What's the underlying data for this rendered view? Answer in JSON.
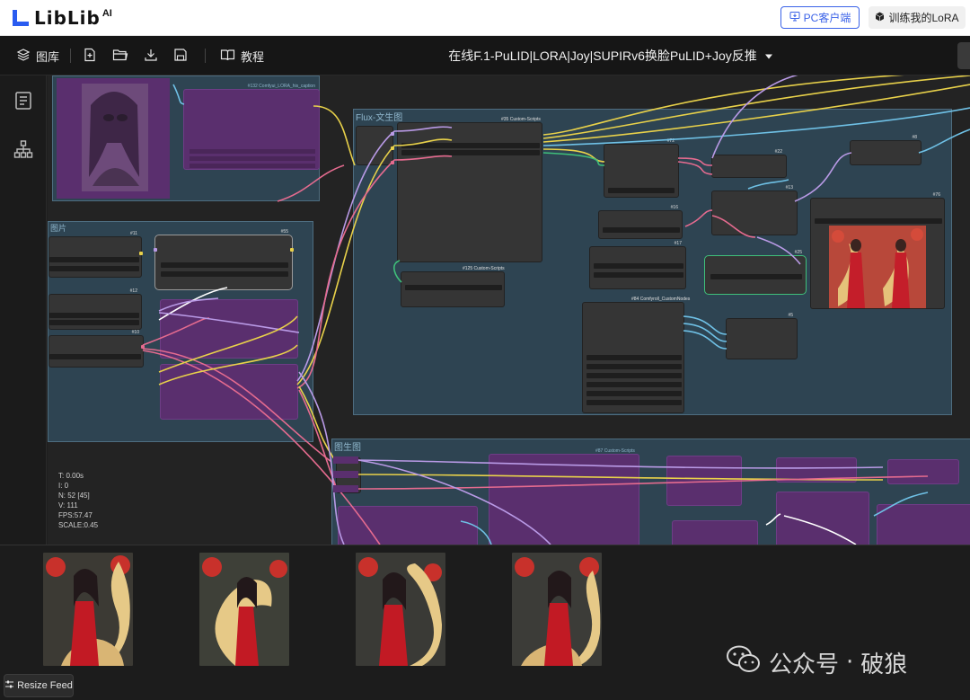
{
  "brand": {
    "logo_text": "LibLib",
    "logo_suffix": "AI"
  },
  "header": {
    "pc_client_label": "PC客户端",
    "train_lora_label": "训练我的LoRA"
  },
  "toolbar": {
    "gallery_label": "图库",
    "tutorial_label": "教程",
    "workflow_title": "在线F.1-PuLID|LORA|Joy|SUPIRv6换脸PuLID+Joy反推"
  },
  "canvas": {
    "groups": {
      "flux_txt2img": "Flux-文生图",
      "img2img": "图生图",
      "left_group": "图片"
    },
    "node_labels": {
      "custom_scripts_35": "#35 Custom-Scripts",
      "custom_scripts_125": "#125 Custom-Scripts",
      "custom_nodes_84": "#84 Comfyroll_CustomNodes",
      "custom_scripts_87": "#87 Custom-Scripts",
      "lora_caption": "#132 Comfyui_LORA_his_caption"
    },
    "node_ids": {
      "n11": "#11",
      "n55": "#55",
      "n12": "#12",
      "n10": "#10",
      "n72": "#72",
      "n22": "#22",
      "n8": "#8",
      "n13": "#13",
      "n76": "#76",
      "n16": "#16",
      "n17": "#17",
      "n25": "#25",
      "n5": "#5"
    },
    "stats": {
      "t": "T: 0.00s",
      "i": "I: 0",
      "n": "N: 52 [45]",
      "v": "V: 111",
      "fps": "FPS:57.47",
      "scale": "SCALE:0.45"
    }
  },
  "feed": {
    "resize_label": "Resize Feed",
    "thumbnails": 4
  },
  "watermark": {
    "brand": "公众号",
    "dot": "·",
    "author": "破狼"
  },
  "colors": {
    "accent_blue": "#3a62e8",
    "group_bg": "#2e4452",
    "node_purple": "#5a2f6e",
    "link_yellow": "#e8d14a",
    "link_pink": "#e56b8f",
    "link_lavender": "#b99ae6",
    "link_blue": "#6fc1e6"
  },
  "icons": [
    "layers-icon",
    "new-file-icon",
    "open-folder-icon",
    "download-icon",
    "save-icon",
    "book-icon",
    "document-icon",
    "node-tree-icon",
    "monitor-icon",
    "cube-icon",
    "chevron-down-icon",
    "resize-icon",
    "wechat-icon"
  ]
}
